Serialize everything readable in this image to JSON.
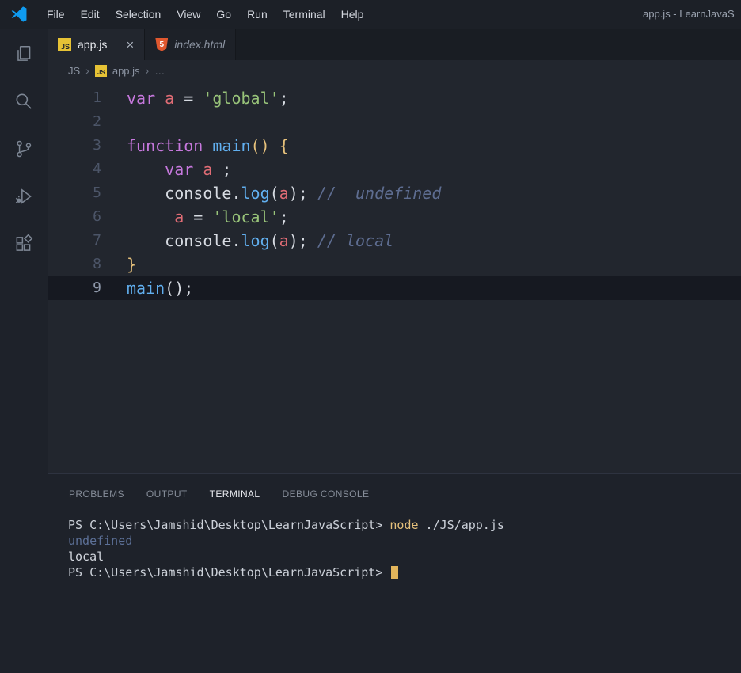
{
  "title_bar": {
    "menu_items": [
      "File",
      "Edit",
      "Selection",
      "View",
      "Go",
      "Run",
      "Terminal",
      "Help"
    ],
    "window_title": "app.js - LearnJavaS"
  },
  "activity_bar": {
    "icons": [
      "explorer-icon",
      "search-icon",
      "source-control-icon",
      "run-debug-icon",
      "extensions-icon"
    ]
  },
  "tabs": [
    {
      "label": "app.js",
      "icon": "javascript-file-icon",
      "icon_text": "JS",
      "close": "×",
      "active": true
    },
    {
      "label": "index.html",
      "icon": "html5-file-icon",
      "icon_text": "5",
      "active": false
    }
  ],
  "breadcrumb": {
    "folder": "JS",
    "separator": "›",
    "file_icon_text": "JS",
    "file": "app.js",
    "more": "…"
  },
  "editor": {
    "lines": [
      {
        "n": "1",
        "tokens": [
          [
            "kw",
            "var"
          ],
          [
            "pl",
            " "
          ],
          [
            "vr",
            "a"
          ],
          [
            "pl",
            " = "
          ],
          [
            "st",
            "'global'"
          ],
          [
            "pl",
            ";"
          ]
        ]
      },
      {
        "n": "2",
        "tokens": []
      },
      {
        "n": "3",
        "tokens": [
          [
            "kw",
            "function"
          ],
          [
            "pl",
            " "
          ],
          [
            "fn",
            "main"
          ],
          [
            "br",
            "()"
          ],
          [
            "pl",
            " "
          ],
          [
            "br",
            "{"
          ]
        ]
      },
      {
        "n": "4",
        "tokens": [
          [
            "pl",
            "    "
          ],
          [
            "kw",
            "var"
          ],
          [
            "pl",
            " "
          ],
          [
            "vr",
            "a"
          ],
          [
            "pl",
            " ;"
          ]
        ]
      },
      {
        "n": "5",
        "tokens": [
          [
            "pl",
            "    console"
          ],
          [
            "pl",
            "."
          ],
          [
            "fn",
            "log"
          ],
          [
            "pl",
            "("
          ],
          [
            "vr",
            "a"
          ],
          [
            "pl",
            "); "
          ],
          [
            "cm",
            "//  undefined"
          ]
        ]
      },
      {
        "n": "6",
        "guide": true,
        "tokens": [
          [
            "pl",
            "     "
          ],
          [
            "vr",
            "a"
          ],
          [
            "pl",
            " = "
          ],
          [
            "st",
            "'local'"
          ],
          [
            "pl",
            ";"
          ]
        ]
      },
      {
        "n": "7",
        "tokens": [
          [
            "pl",
            "    console"
          ],
          [
            "pl",
            "."
          ],
          [
            "fn",
            "log"
          ],
          [
            "pl",
            "("
          ],
          [
            "vr",
            "a"
          ],
          [
            "pl",
            "); "
          ],
          [
            "cm",
            "// local"
          ]
        ]
      },
      {
        "n": "8",
        "tokens": [
          [
            "br",
            "}"
          ]
        ]
      },
      {
        "n": "9",
        "current": true,
        "tokens": [
          [
            "fn",
            "main"
          ],
          [
            "pl",
            "();"
          ]
        ]
      }
    ]
  },
  "panel": {
    "tabs": [
      {
        "label": "PROBLEMS",
        "active": false
      },
      {
        "label": "OUTPUT",
        "active": false
      },
      {
        "label": "TERMINAL",
        "active": true
      },
      {
        "label": "DEBUG CONSOLE",
        "active": false
      }
    ]
  },
  "terminal": {
    "lines": [
      {
        "tokens": [
          [
            "pr",
            "PS C:\\Users\\Jamshid\\Desktop\\LearnJavaScript> "
          ],
          [
            "cmd",
            "node"
          ],
          [
            "pr",
            " ./JS/app.js"
          ]
        ]
      },
      {
        "tokens": [
          [
            "dim",
            "undefined"
          ]
        ]
      },
      {
        "tokens": [
          [
            "out",
            "local"
          ]
        ]
      },
      {
        "cursor": true,
        "tokens": [
          [
            "pr",
            "PS C:\\Users\\Jamshid\\Desktop\\LearnJavaScript> "
          ]
        ]
      }
    ]
  },
  "colors": {
    "keyword_purple": "#c678dd",
    "variable_red": "#e06c75",
    "string_green": "#98c379",
    "function_blue": "#61afef",
    "bracket_gold": "#e5c07b",
    "comment_slate": "#5e6d91",
    "terminal_command_yellow": "#e5c07b",
    "terminal_cursor_gold": "#e2b55b",
    "js_badge_yellow": "#e6c235",
    "html_badge_orange": "#e0582f",
    "vscode_logo_blue": "#0f9bf0",
    "editor_background": "#22262e"
  }
}
